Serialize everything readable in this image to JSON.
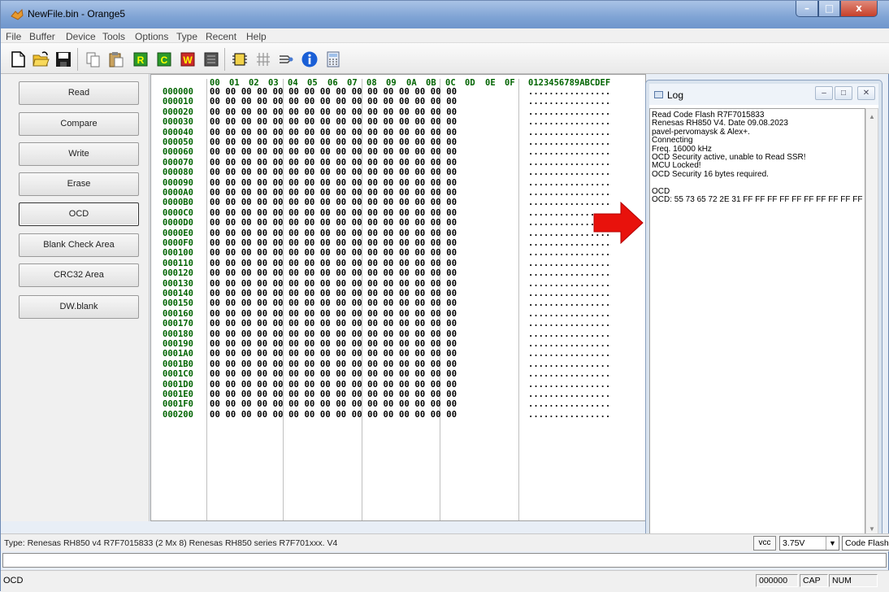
{
  "window": {
    "title": "NewFile.bin - Orange5",
    "min": "–",
    "max": "□",
    "close": "x"
  },
  "menu": [
    "File",
    "Buffer",
    "Device",
    "Tools",
    "Options",
    "Type",
    "Recent",
    "Help"
  ],
  "toolbar": {
    "icons": [
      "new-file-icon",
      "open-folder-icon",
      "save-icon",
      "copy-icon",
      "paste-icon",
      "read-chip-icon",
      "check-chip-icon",
      "write-chip-icon",
      "erase-chip-icon",
      "chip-settings-icon",
      "pins-icon",
      "connect-icon",
      "info-icon",
      "calculator-icon"
    ]
  },
  "left_buttons": [
    "Read",
    "Compare",
    "Write",
    "Erase",
    "OCD",
    "Blank Check Area",
    "CRC32 Area",
    "DW.blank"
  ],
  "hex": {
    "columns": [
      "00",
      "01",
      "02",
      "03",
      "04",
      "05",
      "06",
      "07",
      "08",
      "09",
      "0A",
      "0B",
      "0C",
      "0D",
      "0E",
      "0F"
    ],
    "ascii_header": "0123456789ABCDEF",
    "addresses": [
      "000000",
      "000010",
      "000020",
      "000030",
      "000040",
      "000050",
      "000060",
      "000070",
      "000080",
      "000090",
      "0000A0",
      "0000B0",
      "0000C0",
      "0000D0",
      "0000E0",
      "0000F0",
      "000100",
      "000110",
      "000120",
      "000130",
      "000140",
      "000150",
      "000160",
      "000170",
      "000180",
      "000190",
      "0001A0",
      "0001B0",
      "0001C0",
      "0001D0",
      "0001E0",
      "0001F0",
      "000200"
    ],
    "row_bytes": "00 00 00 00 00 00 00 00 00 00 00 00 00 00 00 00",
    "row_ascii": "................"
  },
  "log": {
    "title": "Log",
    "lines": [
      "Read Code Flash R7F7015833",
      "Renesas RH850 V4. Date 09.08.2023",
      "pavel-pervomaysk & Alex+.",
      "Connecting",
      "Freq. 16000 kHz",
      "OCD Security active, unable to Read SSR!",
      "MCU Locked!",
      "OCD Security 16 bytes required.",
      "",
      "OCD",
      "OCD: 55 73 65 72 2E 31 FF FF FF FF FF FF FF FF FF FF"
    ]
  },
  "status": {
    "type_text": "Type: Renesas RH850 v4 R7F7015833 (2 Mx 8)   Renesas RH850 series R7F701xxx. V4",
    "vcc_label": "vcc",
    "voltage": "3.75V",
    "memory": "Code Flash",
    "bottom_left": "OCD",
    "counter": "000000",
    "cap": "CAP",
    "num": "NUM"
  },
  "colors": {
    "hex_address": "#006400",
    "arrow": "#e8120c"
  }
}
